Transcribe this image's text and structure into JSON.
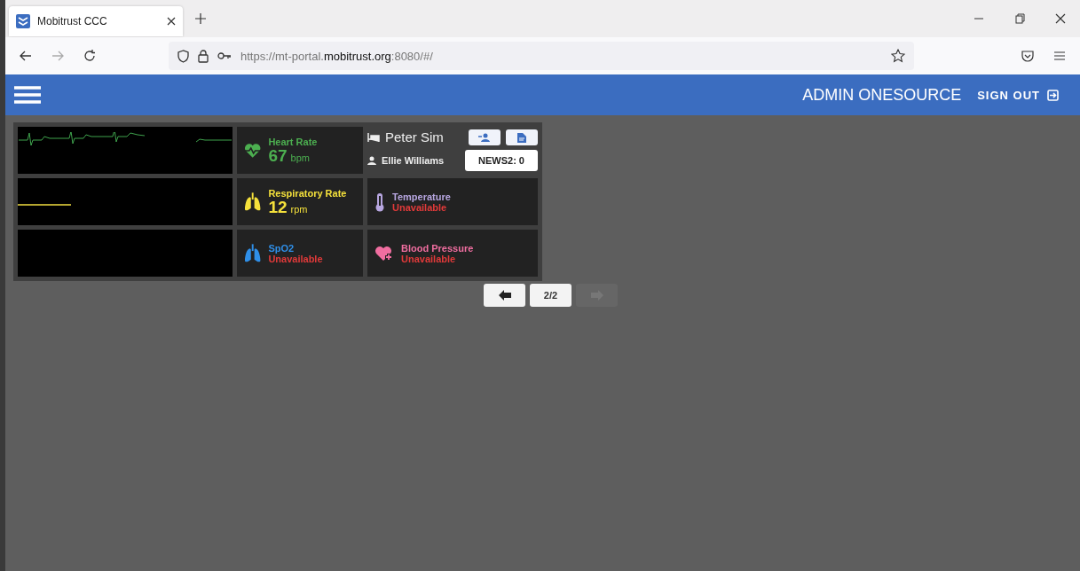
{
  "browser": {
    "tab": {
      "title": "Mobitrust CCC",
      "selected": true
    },
    "url": {
      "prefix": "https://mt-portal.",
      "domain": "mobitrust.org",
      "suffix": ":8080/#/"
    }
  },
  "header": {
    "user": "ADMIN ONESOURCE",
    "sign_out": "SIGN OUT"
  },
  "monitor": {
    "patient": "Peter Sim",
    "clinician": "Ellie Williams",
    "news2": "NEWS2: 0",
    "waves": [
      {
        "kind": "ecg",
        "color": "#3fa34d"
      },
      {
        "kind": "flat",
        "color": "#b5a630"
      },
      {
        "kind": "none"
      }
    ],
    "vitals": [
      {
        "kind": "heart",
        "label": "Heart Rate",
        "value": "67",
        "unit": "bpm",
        "color": "#4caf50"
      },
      {
        "kind": "lungs",
        "label": "Respiratory Rate",
        "value": "12",
        "unit": "rpm",
        "color": "#f5e13b"
      },
      {
        "kind": "thermometer",
        "label": "Temperature",
        "status": "Unavailable",
        "color": "#b7a6e0"
      },
      {
        "kind": "lungs",
        "label": "SpO2",
        "status": "Unavailable",
        "color": "#2f8fe8"
      },
      {
        "kind": "heart-plus",
        "label": "Blood Pressure",
        "status": "Unavailable",
        "color": "#f06ea0"
      }
    ]
  },
  "pager": {
    "label": "2/2",
    "prev_disabled": false,
    "next_disabled": true
  }
}
